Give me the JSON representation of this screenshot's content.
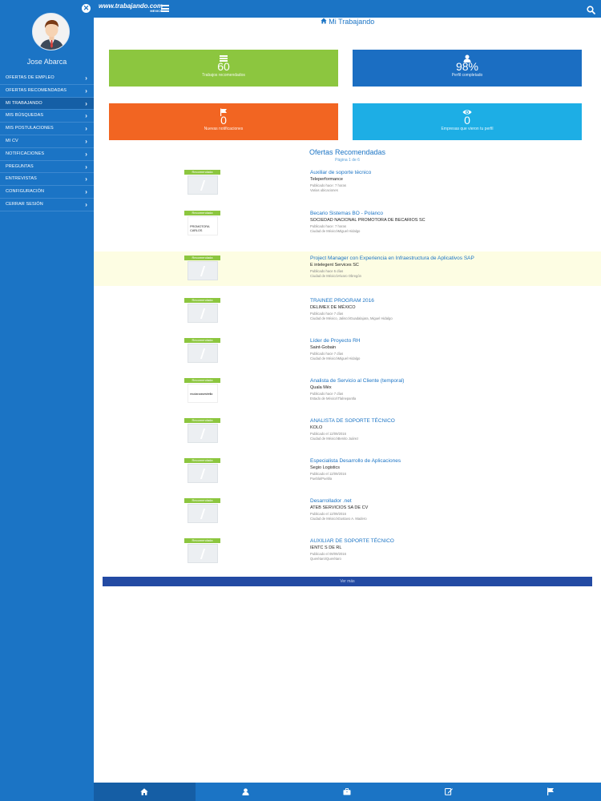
{
  "header": {
    "logo_text": "www.trabajando.com",
    "logo_country": "MEXICO"
  },
  "sidebar": {
    "user_name": "Jose Abarca",
    "items": [
      {
        "label": "OFERTAS DE EMPLEO"
      },
      {
        "label": "OFERTAS RECOMENDADAS"
      },
      {
        "label": "MI TRABAJANDO"
      },
      {
        "label": "MIS BÚSQUEDAS"
      },
      {
        "label": "MIS POSTULACIONES"
      },
      {
        "label": "MI CV"
      },
      {
        "label": "NOTIFICACIONES"
      },
      {
        "label": "PREGUNTAS"
      },
      {
        "label": "ENTREVISTAS"
      },
      {
        "label": "CONFIGURACIÓN"
      },
      {
        "label": "CERRAR SESIÓN"
      }
    ]
  },
  "main": {
    "title": "Mi Trabajando",
    "cards": [
      {
        "value": "60",
        "label": "Trabajos recomendados",
        "color": "#8cc63f"
      },
      {
        "value": "98%",
        "label": "Perfil completado",
        "color": "#1b6ec2"
      },
      {
        "value": "0",
        "label": "Nuevas notificaciones",
        "color": "#f26522"
      },
      {
        "value": "0",
        "label": "Empresas que vieron tu perfil",
        "color": "#1daee5"
      }
    ],
    "section_title": "Ofertas Recomendadas",
    "pagination": "Página 1 de 6",
    "badge_label": "Recomendada",
    "jobs": [
      {
        "title": "Auxiliar de soporte técnico",
        "company": "Teleperformance",
        "published": "Publicado hace: 7 horas",
        "location": "Varias ubicaciones"
      },
      {
        "title": "Becario Sistemas BO - Polanco",
        "company": "SOCIEDAD NACIONAL PROMOTORA DE BECARIOS SC",
        "published": "Publicado hace: 7 horas",
        "location": "Ciudad de México\\Miguel Hidalgo",
        "logo": "PROMOTORA CARLOS"
      },
      {
        "title": "Project Manager con Experiencia en Infraestructura de Aplicativos SAP",
        "company": "E intelegent Services SC",
        "published": "Publicado hace 5 días",
        "location": "Ciudad de México\\Alvaro Obregón"
      },
      {
        "title": "TRAINEE PROGRAM 2016",
        "company": "DELIMEX DE MÉXICO",
        "published": "Publicado hace 7 días",
        "location": "Ciudad de México, Jalisco\\Guadalajara, Miguel Hidalgo"
      },
      {
        "title": "Líder de Proyecto RH",
        "company": "Saint-Gobain",
        "published": "Publicado hace 7 días",
        "location": "Ciudad de México\\Miguel Hidalgo"
      },
      {
        "title": "Analista de Servicio al Cliente (temporal)",
        "company": "Quala Méx",
        "published": "Publicado hace 7 días",
        "location": "Estado de México\\Tlalnepantla",
        "logo": "mudanzasestrella"
      },
      {
        "title": "ANALISTA DE SOPORTE TÉCNICO",
        "company": "KOLO",
        "published": "Publicado el 12/09/2016",
        "location": "Ciudad de México\\Benito Juárez"
      },
      {
        "title": "Especialista Desarrollo de Aplicaciones",
        "company": "Segio Logistics",
        "published": "Publicado el 12/09/2016",
        "location": "Puebla\\Puebla"
      },
      {
        "title": "Desarrollador .net",
        "company": "ATEB SERVICIOS SA DE CV",
        "published": "Publicado el 12/09/2016",
        "location": "Ciudad de México\\Gustavo A. Madero"
      },
      {
        "title": "AUXILIAR DE SOPORTE TÉCNICO",
        "company": "IENTC S DE RL",
        "published": "Publicado el 09/09/2016",
        "location": "Querétaro\\Querétaro"
      }
    ],
    "more_button": "Ver más"
  },
  "bottom_nav": {
    "tabs": [
      {
        "icon": "home-icon",
        "active": true
      },
      {
        "icon": "user-icon"
      },
      {
        "icon": "briefcase-icon"
      },
      {
        "icon": "edit-icon"
      },
      {
        "icon": "flag-icon"
      }
    ]
  },
  "colors": {
    "primary": "#1b74c5",
    "green": "#8cc63f",
    "orange": "#f26522",
    "cyan": "#1daee5",
    "highlight_row": "#fdfde3"
  }
}
